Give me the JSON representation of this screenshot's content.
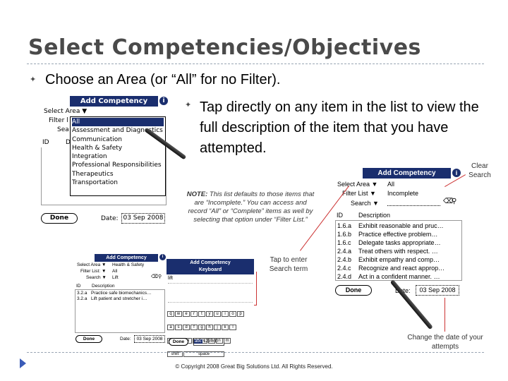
{
  "slide": {
    "title": "Select Competencies/Objectives",
    "bullet1": "Choose an Area (or “All” for no Filter).",
    "bullet2": "Tap directly on any item in the list to view the full description of the item that you have attempted.",
    "note_bold": "NOTE:",
    "note_text": " This list defaults to those items that are “Incomplete.” You can access and record “All” or “Complete” items as well by selecting that option under “Filter List.”",
    "callout_clear": "Clear Search",
    "callout_tap": "Tap to enter Search term",
    "callout_date": "Change the date of your attempts",
    "copyright": "© Copyright 2008 Great Big Solutions Ltd. All Rights Reserved."
  },
  "screen1": {
    "title": "Add Competency",
    "select_area": "Select Area ▼",
    "filter_label": "Filter l",
    "search_label": "Sea",
    "id_col": "ID",
    "desc_col": "D",
    "menu_items": [
      "All",
      "Assessment and Diagnostics",
      "Communication",
      "Health & Safety",
      "Integration",
      "Professional Responsibilities",
      "Therapeutics",
      "Transportation"
    ],
    "done": "Done",
    "date_label": "Date:",
    "date_value": "03 Sep 2008"
  },
  "screen2": {
    "title": "Add Competency",
    "select_area_label": "Select Area ▼",
    "select_area_value": "All",
    "filter_label": "Filter List ▼",
    "filter_value": "Incomplete",
    "search_label": "Search ▼",
    "id_col": "ID",
    "desc_col": "Description",
    "rows": [
      {
        "id": "1.6.a",
        "desc": "Exhibit reasonable and pruc…"
      },
      {
        "id": "1.6.b",
        "desc": "Practice effective problem…"
      },
      {
        "id": "1.6.c",
        "desc": "Delegate tasks appropriate…"
      },
      {
        "id": "2.4.a",
        "desc": "Treat others with respect. …"
      },
      {
        "id": "2.4.b",
        "desc": "Exhibit empathy and comp…"
      },
      {
        "id": "2.4.c",
        "desc": "Recognize and react approp…"
      },
      {
        "id": "2.4.d",
        "desc": "Act in a confident manner. …"
      }
    ],
    "done": "Done",
    "date_label": "Date:",
    "date_value": "03 Sep 2008"
  },
  "screen3": {
    "title": "Add Competency",
    "select_area_label": "Select Area ▼",
    "select_area_value": "Health & Safety",
    "filter_label": "Filter List: ▼",
    "filter_value": "All",
    "search_label": "Search ▼",
    "search_value": "Lift",
    "id_col": "ID",
    "desc_col": "Description",
    "rows": [
      {
        "id": "3.2.a",
        "desc": "Practice safe biomechanics…"
      },
      {
        "id": "3.2.a",
        "desc": "Lift patient and stretcher i…"
      }
    ],
    "done": "Done",
    "date_label": "Date:",
    "date_value": "03 Sep 2008"
  },
  "screen4": {
    "title": "Add Competency",
    "subtitle": "Keyboard",
    "input_value": "lift",
    "row1": [
      "q",
      "w",
      "e",
      "r",
      "t",
      "y",
      "u",
      "i",
      "o",
      "p"
    ],
    "row2": [
      "a",
      "s",
      "d",
      "f",
      "g",
      "h",
      "j",
      "k",
      "l"
    ],
    "row3": [
      "z",
      "x",
      "c",
      "v",
      "b",
      "n",
      "m"
    ],
    "cap": "cap",
    "shift": "shift",
    "space": "space",
    "done": "Done",
    "mode1": "abc",
    "mode2": "123",
    "mode3": "Int'l"
  }
}
